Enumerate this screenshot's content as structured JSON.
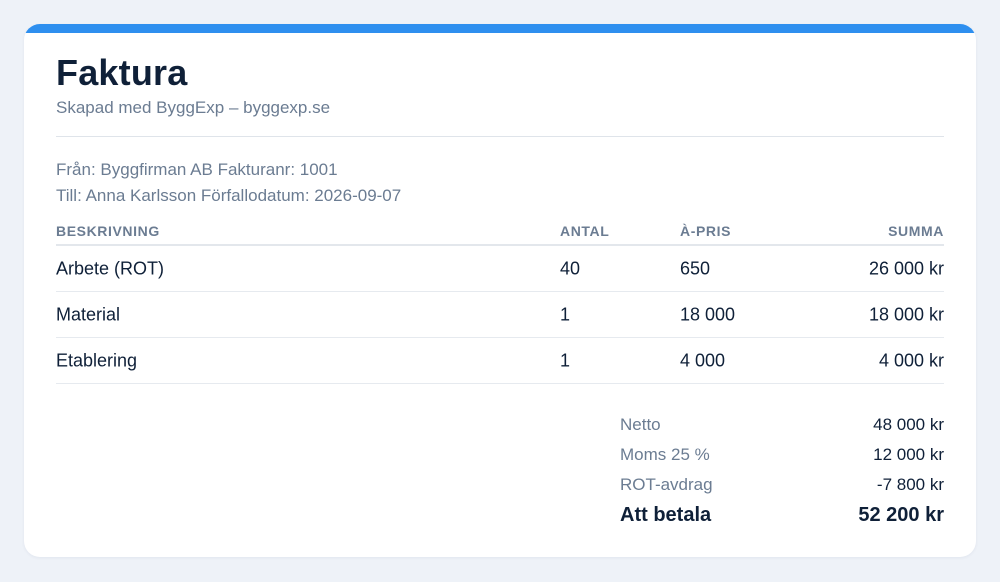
{
  "invoice": {
    "title": "Faktura",
    "subtitle": "Skapad med ByggExp – byggexp.se",
    "meta_line_1": "Från: Byggfirman AB Fakturanr: 1001",
    "meta_line_2": "Till: Anna Karlsson Förfallodatum: 2026-09-07"
  },
  "table": {
    "headers": [
      "BESKRIVNING",
      "ANTAL",
      "À-PRIS",
      "SUMMA"
    ],
    "rows": [
      [
        "Arbete (ROT)",
        "40",
        "650",
        "26 000 kr"
      ],
      [
        "Material",
        "1",
        "18 000",
        "18 000 kr"
      ],
      [
        "Etablering",
        "1",
        "4 000",
        "4 000 kr"
      ]
    ]
  },
  "totals": {
    "netto_label": "Netto",
    "netto_value": "48 000 kr",
    "moms_label": "Moms 25 %",
    "moms_value": "12 000 kr",
    "rot_label": "ROT-avdrag",
    "rot_value": "-7 800 kr",
    "pay_label": "Att betala",
    "pay_value": "52 200 kr"
  },
  "colors": {
    "accent": "#2e8fef",
    "background": "#eef2f8",
    "text": "#0f2038",
    "muted": "#6b7c92"
  }
}
